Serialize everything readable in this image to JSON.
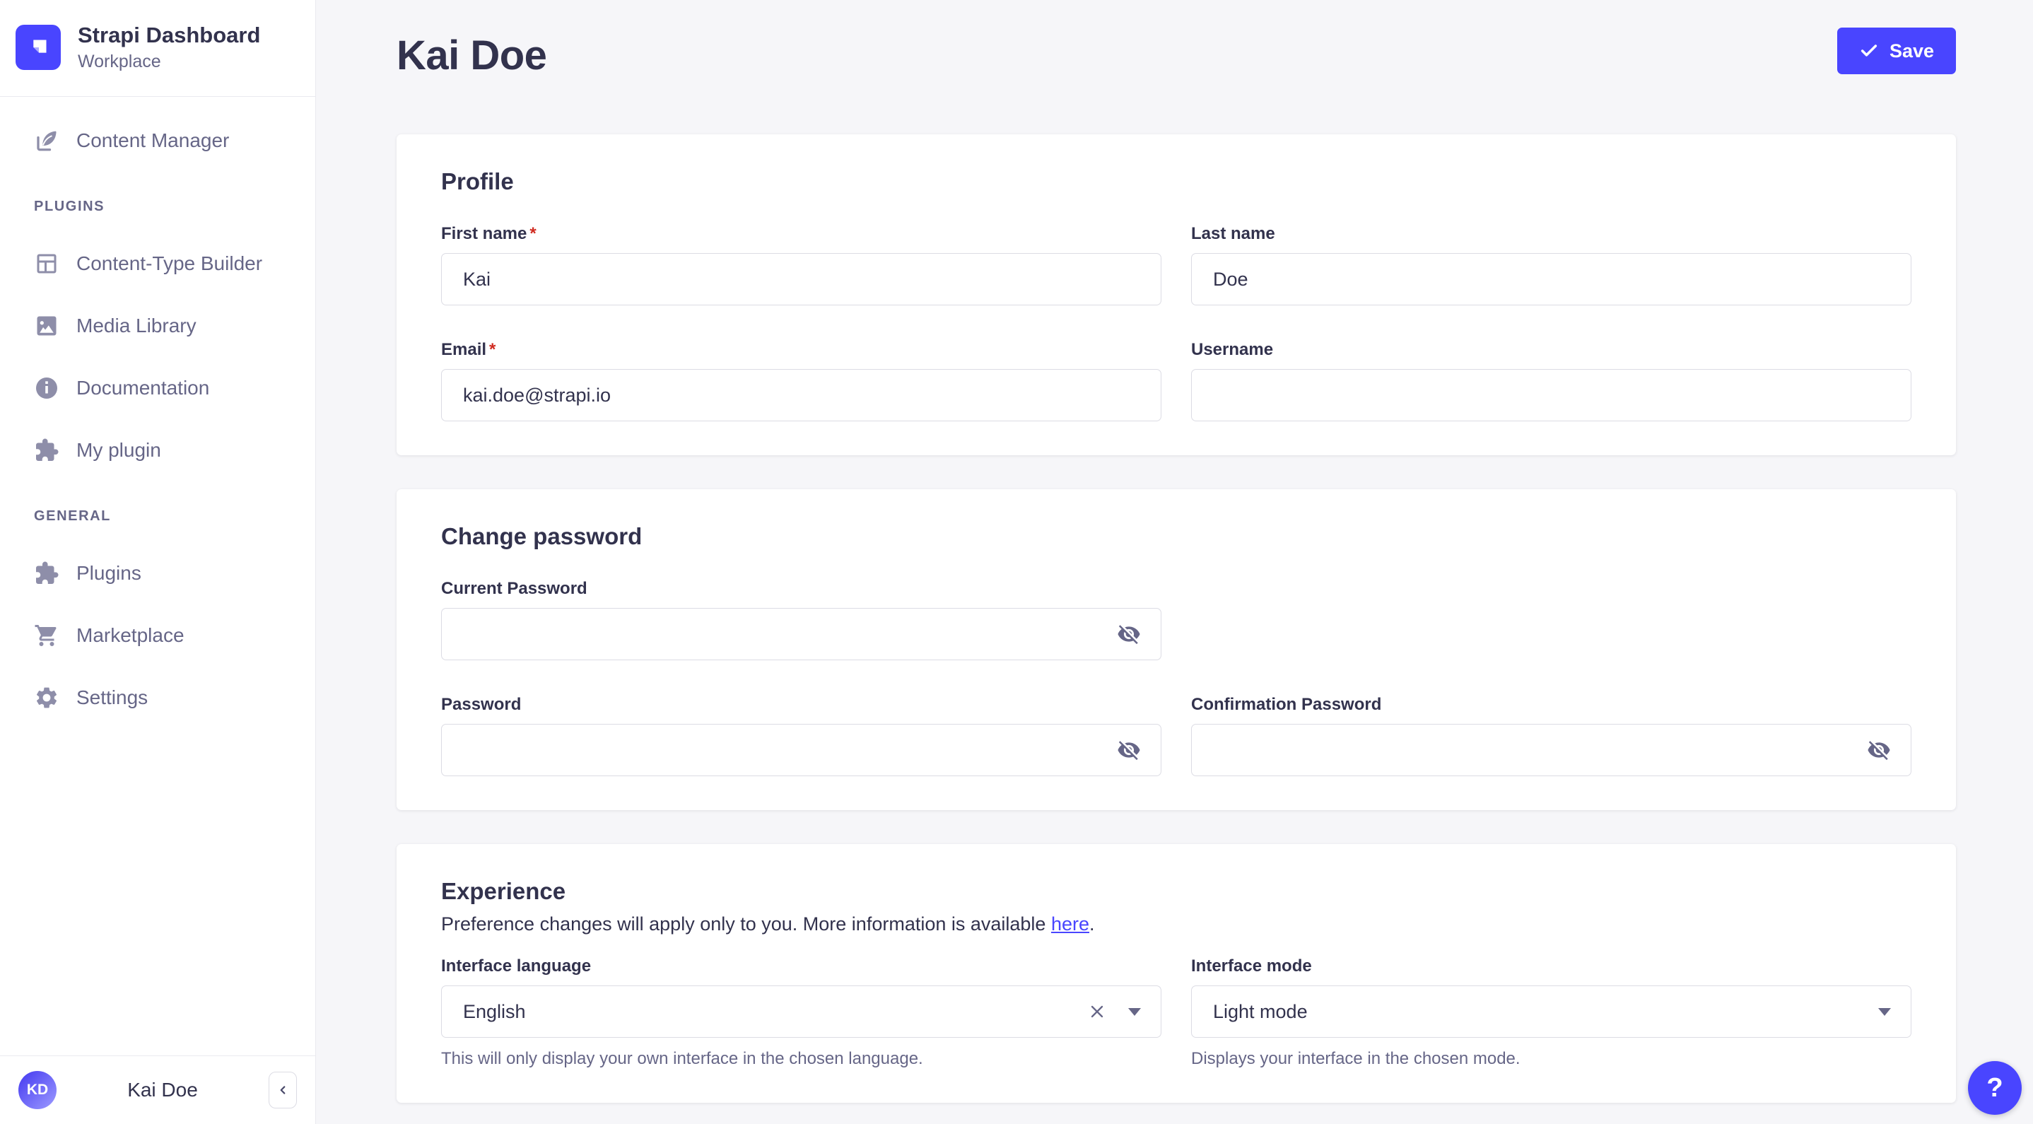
{
  "ui": {
    "required_mark": "*"
  },
  "colors": {
    "primary": "#4945ff",
    "title_text": "#32324d",
    "muted_text": "#666687",
    "icon_gray": "#8e8ea9",
    "border": "#dcdce4",
    "background": "#f6f6f9",
    "card": "#ffffff",
    "required_red": "#d02b20"
  },
  "app": {
    "name": "Strapi Dashboard",
    "workspace": "Workplace"
  },
  "sidebar": {
    "content_manager": {
      "label": "Content Manager",
      "icon": "feather-pen-icon"
    },
    "plugins_header": "PLUGINS",
    "plugins_items": [
      {
        "label": "Content-Type Builder",
        "icon": "layout-icon"
      },
      {
        "label": "Media Library",
        "icon": "image-icon"
      },
      {
        "label": "Documentation",
        "icon": "info-icon"
      },
      {
        "label": "My plugin",
        "icon": "puzzle-icon"
      }
    ],
    "general_header": "GENERAL",
    "general_items": [
      {
        "label": "Plugins",
        "icon": "puzzle-icon"
      },
      {
        "label": "Marketplace",
        "icon": "cart-icon"
      },
      {
        "label": "Settings",
        "icon": "gear-icon"
      }
    ],
    "user": {
      "initials": "KD",
      "name": "Kai Doe"
    }
  },
  "header": {
    "title": "Kai Doe",
    "save_button": "Save"
  },
  "profile_card": {
    "heading": "Profile",
    "first_name": {
      "label": "First name",
      "value": "Kai",
      "required": true
    },
    "last_name": {
      "label": "Last name",
      "value": "Doe"
    },
    "email": {
      "label": "Email",
      "value": "kai.doe@strapi.io",
      "required": true
    },
    "username": {
      "label": "Username",
      "value": ""
    }
  },
  "password_card": {
    "heading": "Change password",
    "current_password": {
      "label": "Current Password",
      "value": ""
    },
    "password": {
      "label": "Password",
      "value": ""
    },
    "confirmation_password": {
      "label": "Confirmation Password",
      "value": ""
    }
  },
  "experience_card": {
    "heading": "Experience",
    "description": "Preference changes will apply only to you. More information is available ",
    "link_text": "here",
    "description_suffix": ".",
    "interface_language": {
      "label": "Interface language",
      "value": "English",
      "hint": "This will only display your own interface in the chosen language."
    },
    "interface_mode": {
      "label": "Interface mode",
      "value": "Light mode",
      "hint": "Displays your interface in the chosen mode."
    }
  },
  "help_button": "?"
}
